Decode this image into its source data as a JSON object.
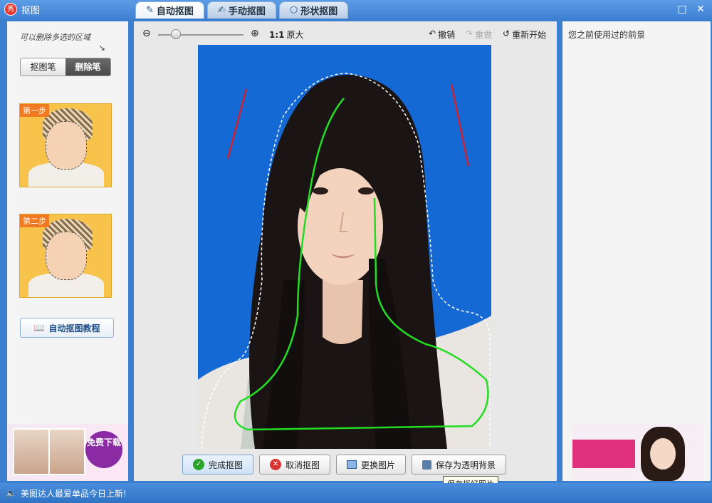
{
  "window": {
    "title": "抠图",
    "logo_text": "秀",
    "tabs": [
      {
        "label": "自动抠图",
        "icon": "brush-icon",
        "active": true
      },
      {
        "label": "手动抠图",
        "icon": "hand-brush-icon",
        "active": false
      },
      {
        "label": "形状抠图",
        "icon": "shape-icon",
        "active": false
      }
    ]
  },
  "left": {
    "hint": "可以删除多选的区域",
    "pen_buttons": [
      "抠图笔",
      "删除笔"
    ],
    "active_pen": "删除笔",
    "steps": [
      "第一步",
      "第二步"
    ],
    "tutorial_label": "自动抠图教程",
    "ad_badge": "免费下载"
  },
  "toolbar": {
    "scale": "1:1",
    "orig_label": "原大",
    "undo": "撤销",
    "redo": "重做",
    "restart": "重新开始",
    "zoom_level": 0.15
  },
  "actions": {
    "finish": "完成抠图",
    "cancel": "取消抠图",
    "replace": "更换图片",
    "save_transparent": "保存为透明背景",
    "tooltip": "保存抠好图片"
  },
  "right": {
    "title": "您之前使用过的前景"
  },
  "statusbar": {
    "text": "美图达人最爱单品今日上新!"
  },
  "colors": {
    "photo_bg": "#1569d4",
    "keep_stroke": "#22dd22",
    "delete_stroke": "#cc2233"
  }
}
